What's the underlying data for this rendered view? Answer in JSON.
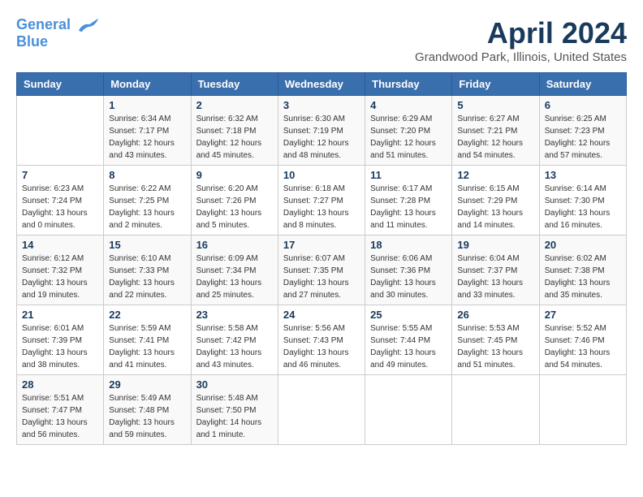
{
  "header": {
    "logo_line1": "General",
    "logo_line2": "Blue",
    "title": "April 2024",
    "location": "Grandwood Park, Illinois, United States"
  },
  "days_of_week": [
    "Sunday",
    "Monday",
    "Tuesday",
    "Wednesday",
    "Thursday",
    "Friday",
    "Saturday"
  ],
  "weeks": [
    [
      {
        "day": "",
        "info": ""
      },
      {
        "day": "1",
        "info": "Sunrise: 6:34 AM\nSunset: 7:17 PM\nDaylight: 12 hours\nand 43 minutes."
      },
      {
        "day": "2",
        "info": "Sunrise: 6:32 AM\nSunset: 7:18 PM\nDaylight: 12 hours\nand 45 minutes."
      },
      {
        "day": "3",
        "info": "Sunrise: 6:30 AM\nSunset: 7:19 PM\nDaylight: 12 hours\nand 48 minutes."
      },
      {
        "day": "4",
        "info": "Sunrise: 6:29 AM\nSunset: 7:20 PM\nDaylight: 12 hours\nand 51 minutes."
      },
      {
        "day": "5",
        "info": "Sunrise: 6:27 AM\nSunset: 7:21 PM\nDaylight: 12 hours\nand 54 minutes."
      },
      {
        "day": "6",
        "info": "Sunrise: 6:25 AM\nSunset: 7:23 PM\nDaylight: 12 hours\nand 57 minutes."
      }
    ],
    [
      {
        "day": "7",
        "info": "Sunrise: 6:23 AM\nSunset: 7:24 PM\nDaylight: 13 hours\nand 0 minutes."
      },
      {
        "day": "8",
        "info": "Sunrise: 6:22 AM\nSunset: 7:25 PM\nDaylight: 13 hours\nand 2 minutes."
      },
      {
        "day": "9",
        "info": "Sunrise: 6:20 AM\nSunset: 7:26 PM\nDaylight: 13 hours\nand 5 minutes."
      },
      {
        "day": "10",
        "info": "Sunrise: 6:18 AM\nSunset: 7:27 PM\nDaylight: 13 hours\nand 8 minutes."
      },
      {
        "day": "11",
        "info": "Sunrise: 6:17 AM\nSunset: 7:28 PM\nDaylight: 13 hours\nand 11 minutes."
      },
      {
        "day": "12",
        "info": "Sunrise: 6:15 AM\nSunset: 7:29 PM\nDaylight: 13 hours\nand 14 minutes."
      },
      {
        "day": "13",
        "info": "Sunrise: 6:14 AM\nSunset: 7:30 PM\nDaylight: 13 hours\nand 16 minutes."
      }
    ],
    [
      {
        "day": "14",
        "info": "Sunrise: 6:12 AM\nSunset: 7:32 PM\nDaylight: 13 hours\nand 19 minutes."
      },
      {
        "day": "15",
        "info": "Sunrise: 6:10 AM\nSunset: 7:33 PM\nDaylight: 13 hours\nand 22 minutes."
      },
      {
        "day": "16",
        "info": "Sunrise: 6:09 AM\nSunset: 7:34 PM\nDaylight: 13 hours\nand 25 minutes."
      },
      {
        "day": "17",
        "info": "Sunrise: 6:07 AM\nSunset: 7:35 PM\nDaylight: 13 hours\nand 27 minutes."
      },
      {
        "day": "18",
        "info": "Sunrise: 6:06 AM\nSunset: 7:36 PM\nDaylight: 13 hours\nand 30 minutes."
      },
      {
        "day": "19",
        "info": "Sunrise: 6:04 AM\nSunset: 7:37 PM\nDaylight: 13 hours\nand 33 minutes."
      },
      {
        "day": "20",
        "info": "Sunrise: 6:02 AM\nSunset: 7:38 PM\nDaylight: 13 hours\nand 35 minutes."
      }
    ],
    [
      {
        "day": "21",
        "info": "Sunrise: 6:01 AM\nSunset: 7:39 PM\nDaylight: 13 hours\nand 38 minutes."
      },
      {
        "day": "22",
        "info": "Sunrise: 5:59 AM\nSunset: 7:41 PM\nDaylight: 13 hours\nand 41 minutes."
      },
      {
        "day": "23",
        "info": "Sunrise: 5:58 AM\nSunset: 7:42 PM\nDaylight: 13 hours\nand 43 minutes."
      },
      {
        "day": "24",
        "info": "Sunrise: 5:56 AM\nSunset: 7:43 PM\nDaylight: 13 hours\nand 46 minutes."
      },
      {
        "day": "25",
        "info": "Sunrise: 5:55 AM\nSunset: 7:44 PM\nDaylight: 13 hours\nand 49 minutes."
      },
      {
        "day": "26",
        "info": "Sunrise: 5:53 AM\nSunset: 7:45 PM\nDaylight: 13 hours\nand 51 minutes."
      },
      {
        "day": "27",
        "info": "Sunrise: 5:52 AM\nSunset: 7:46 PM\nDaylight: 13 hours\nand 54 minutes."
      }
    ],
    [
      {
        "day": "28",
        "info": "Sunrise: 5:51 AM\nSunset: 7:47 PM\nDaylight: 13 hours\nand 56 minutes."
      },
      {
        "day": "29",
        "info": "Sunrise: 5:49 AM\nSunset: 7:48 PM\nDaylight: 13 hours\nand 59 minutes."
      },
      {
        "day": "30",
        "info": "Sunrise: 5:48 AM\nSunset: 7:50 PM\nDaylight: 14 hours\nand 1 minute."
      },
      {
        "day": "",
        "info": ""
      },
      {
        "day": "",
        "info": ""
      },
      {
        "day": "",
        "info": ""
      },
      {
        "day": "",
        "info": ""
      }
    ]
  ]
}
